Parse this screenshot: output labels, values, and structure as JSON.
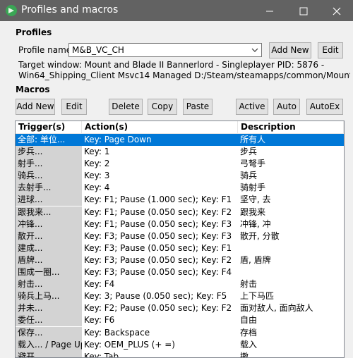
{
  "window": {
    "title": "Profiles and macros"
  },
  "profiles": {
    "section": "Profiles",
    "name_label": "Profile name",
    "name_value": "M&B_VC_CH",
    "add_new": "Add New",
    "edit": "Edit",
    "target_line1": "Target window: Mount and Blade II Bannerlord - Singleplayer PID: 5876 -",
    "target_line2": "Win64_Shipping_Client Msvc14 Managed D:/Steam/steamapps/common/Mount & Blade"
  },
  "macros": {
    "section": "Macros",
    "buttons": {
      "add_new": "Add New",
      "edit": "Edit",
      "delete": "Delete",
      "copy": "Copy",
      "paste": "Paste",
      "active": "Active",
      "auto": "Auto",
      "autoex": "AutoEx"
    },
    "columns": {
      "trigger": "Trigger(s)",
      "action": "Action(s)",
      "description": "Description"
    },
    "rows": [
      {
        "trigger": "全部: 单位...",
        "action": "Key: Page Down",
        "description": "所有人"
      },
      {
        "trigger": "步兵...",
        "action": "Key: 1",
        "description": "步兵"
      },
      {
        "trigger": "射手...",
        "action": "Key: 2",
        "description": "弓弩手"
      },
      {
        "trigger": "骑兵...",
        "action": "Key: 3",
        "description": "骑兵"
      },
      {
        "trigger": "去射手...",
        "action": "Key: 4",
        "description": "骑射手"
      },
      {
        "trigger": "进球...",
        "action": "Key: F1; Pause (1.000 sec); Key: F1",
        "description": "坚守, 去"
      },
      {
        "trigger": "跟我来...",
        "action": "Key: F1; Pause (0.050 sec); Key: F2",
        "description": "跟我来"
      },
      {
        "trigger": "冲锋...",
        "action": "Key: F1; Pause (0.050 sec); Key: F3",
        "description": "冲锋, 冲"
      },
      {
        "trigger": "散开...",
        "action": "Key: F3; Pause (0.050 sec); Key: F3",
        "description": "散开, 分散"
      },
      {
        "trigger": "建成...",
        "action": "Key: F3; Pause (0.050 sec); Key: F1",
        "description": ""
      },
      {
        "trigger": "盾牌...",
        "action": "Key: F3; Pause (0.050 sec); Key: F2",
        "description": "盾, 盾牌"
      },
      {
        "trigger": "围成一圈...",
        "action": "Key: F3; Pause (0.050 sec); Key: F4",
        "description": ""
      },
      {
        "trigger": "射击...",
        "action": "Key: F4",
        "description": "射击"
      },
      {
        "trigger": "骑兵上马...",
        "action": "Key: 3; Pause (0.050 sec); Key: F5",
        "description": "上下马匹"
      },
      {
        "trigger": "并未...",
        "action": "Key: F2; Pause (0.050 sec); Key: F2",
        "description": "面对敌人, 面向敌人"
      },
      {
        "trigger": "委任...",
        "action": "Key: F6",
        "description": "自由"
      },
      {
        "trigger": "保存...",
        "action": "Key: Backspace",
        "description": "存档"
      },
      {
        "trigger": "载入... / Page Up",
        "action": "Key: OEM_PLUS (+ =)",
        "description": "载入"
      },
      {
        "trigger": "避开...",
        "action": "Key: Tab",
        "description": "撤"
      }
    ]
  },
  "colors": {
    "titlebar": "#626262",
    "selection": "#0078d7"
  },
  "icons": {
    "app": "app-icon",
    "dropdown": "chevron-down-icon"
  }
}
